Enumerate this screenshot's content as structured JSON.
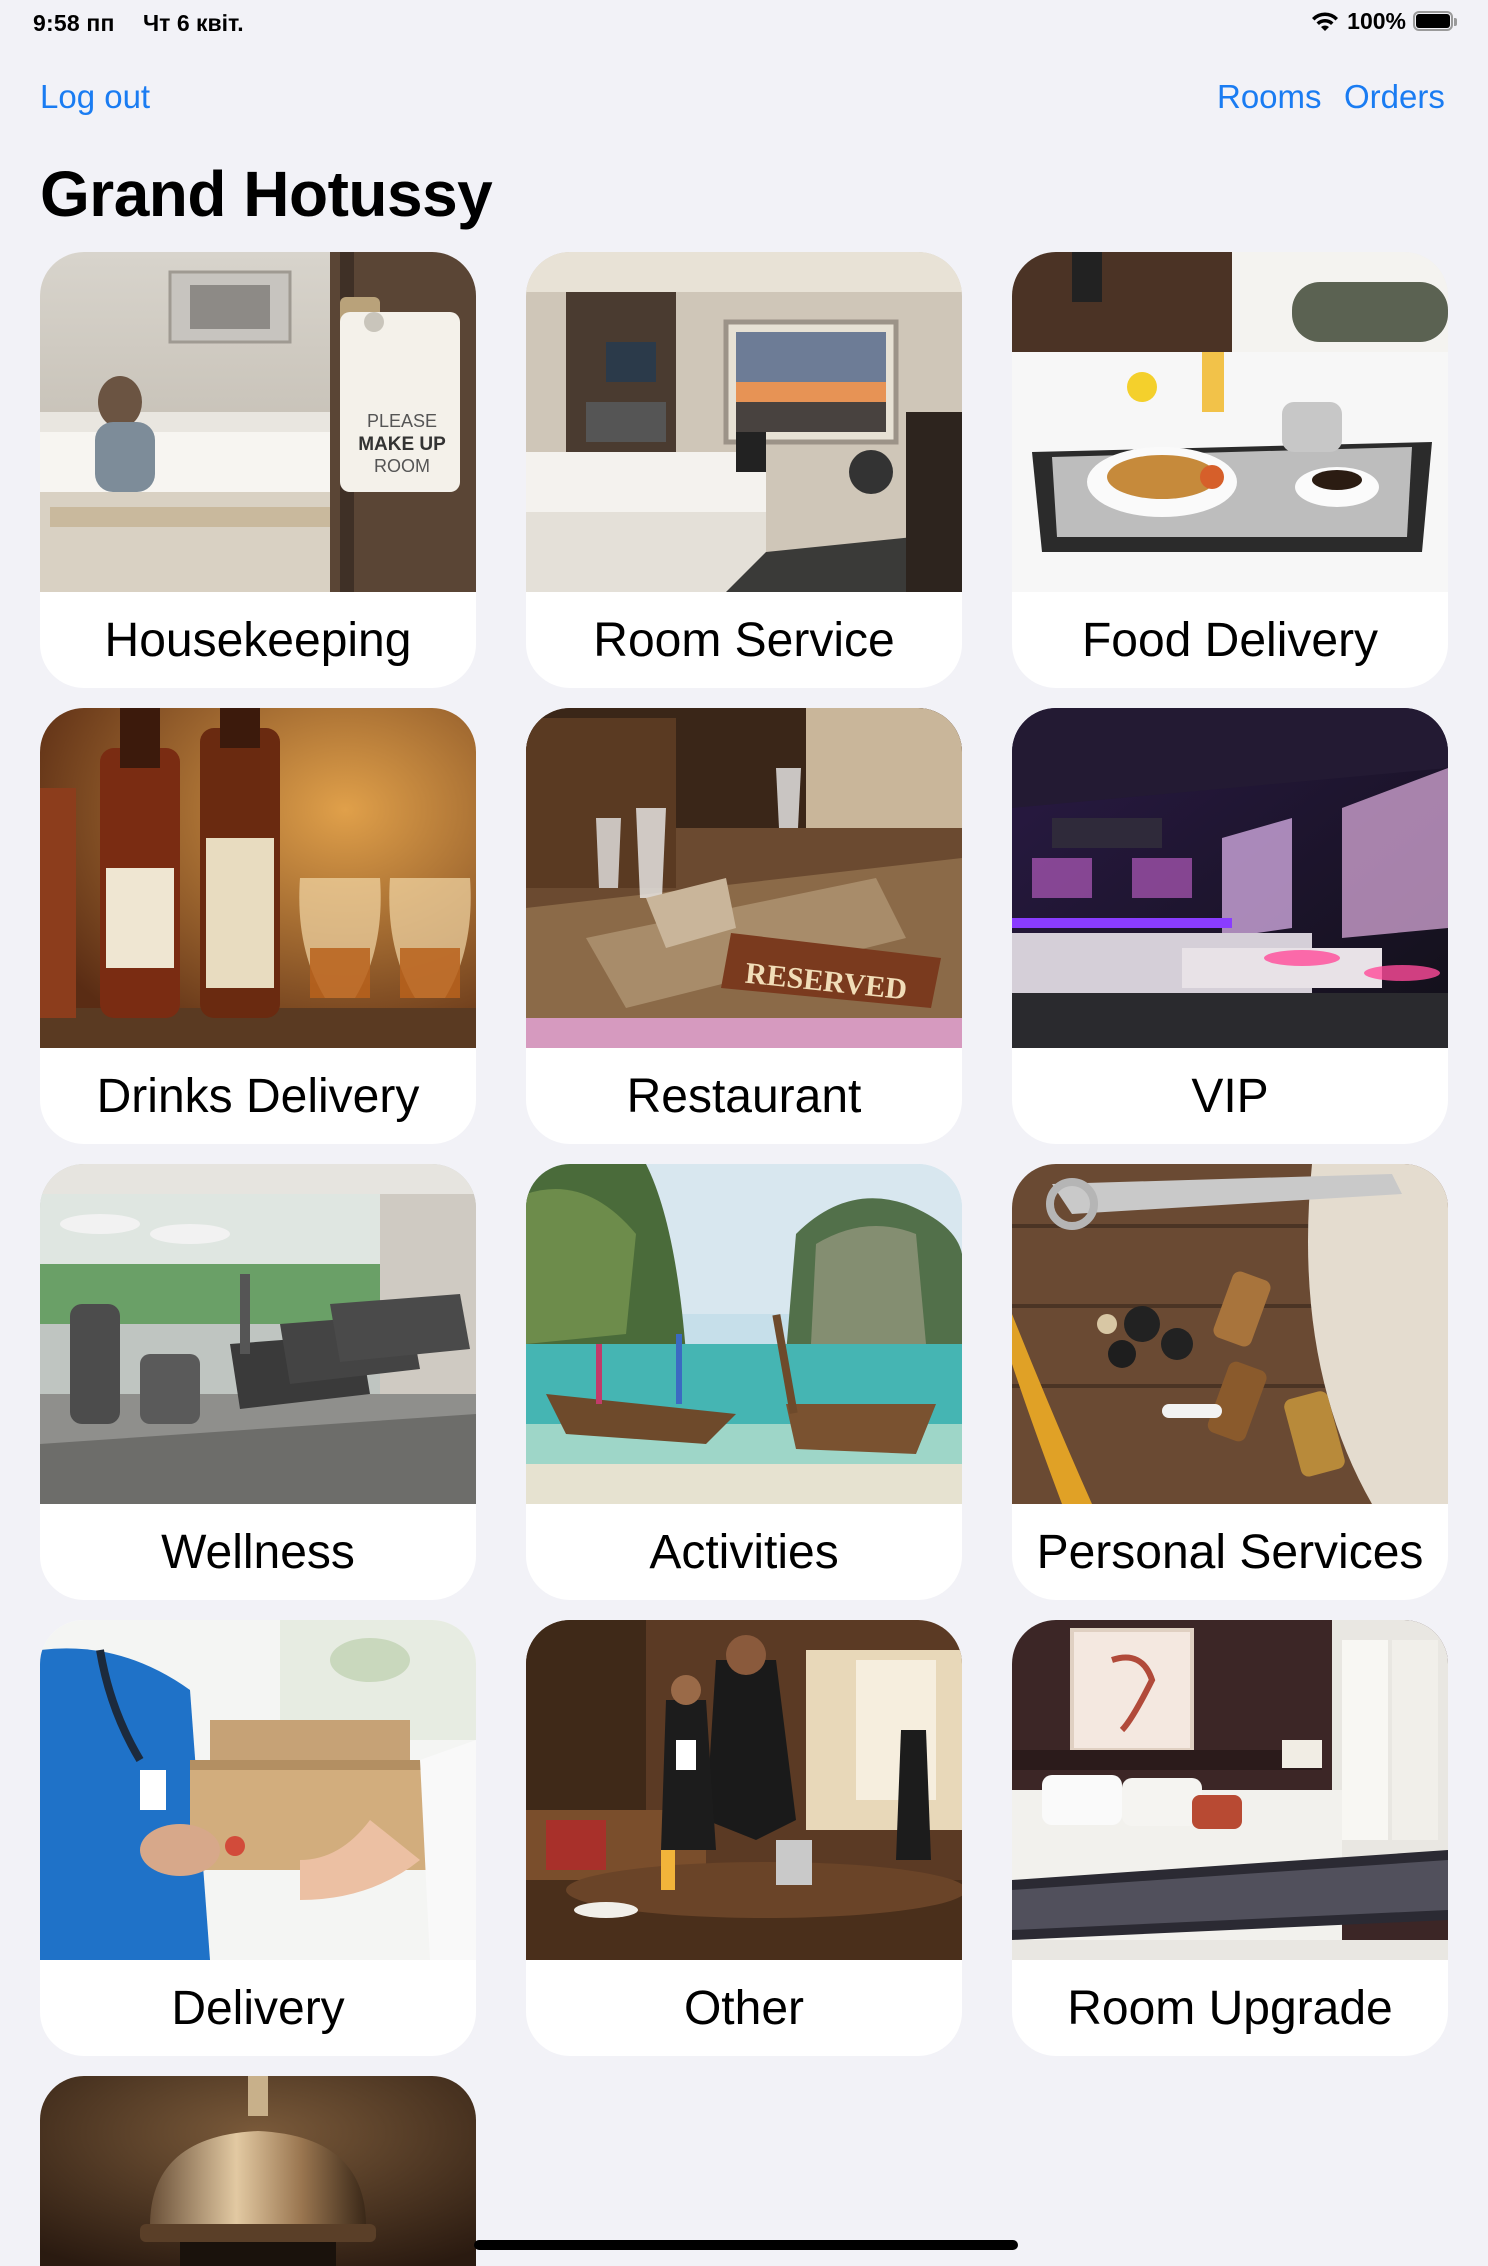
{
  "status_bar": {
    "time": "9:58 пп",
    "date": "Чт 6 квіт.",
    "battery": "100%",
    "wifi_icon": "wifi-icon",
    "battery_icon": "battery-icon"
  },
  "nav": {
    "logout": "Log out",
    "rooms": "Rooms",
    "orders": "Orders",
    "link_color": "#1a7cf2"
  },
  "title": "Grand Hotussy",
  "services": [
    {
      "label": "Housekeeping",
      "image": "housekeeping-photo"
    },
    {
      "label": "Room Service",
      "image": "room-service-photo"
    },
    {
      "label": "Food Delivery",
      "image": "food-delivery-photo"
    },
    {
      "label": "Drinks Delivery",
      "image": "drinks-delivery-photo"
    },
    {
      "label": "Restaurant",
      "image": "restaurant-photo"
    },
    {
      "label": "VIP",
      "image": "vip-photo"
    },
    {
      "label": "Wellness",
      "image": "wellness-photo"
    },
    {
      "label": "Activities",
      "image": "activities-photo"
    },
    {
      "label": "Personal Services",
      "image": "personal-services-photo"
    },
    {
      "label": "Delivery",
      "image": "delivery-photo"
    },
    {
      "label": "Other",
      "image": "other-photo"
    },
    {
      "label": "Room Upgrade",
      "image": "room-upgrade-photo"
    },
    {
      "label": "",
      "image": "reception-bell-photo"
    }
  ],
  "photo_text": {
    "door_sign": [
      "PLEASE",
      "MAKE UP",
      "ROOM"
    ],
    "reserved_sign": "RESERVED"
  }
}
